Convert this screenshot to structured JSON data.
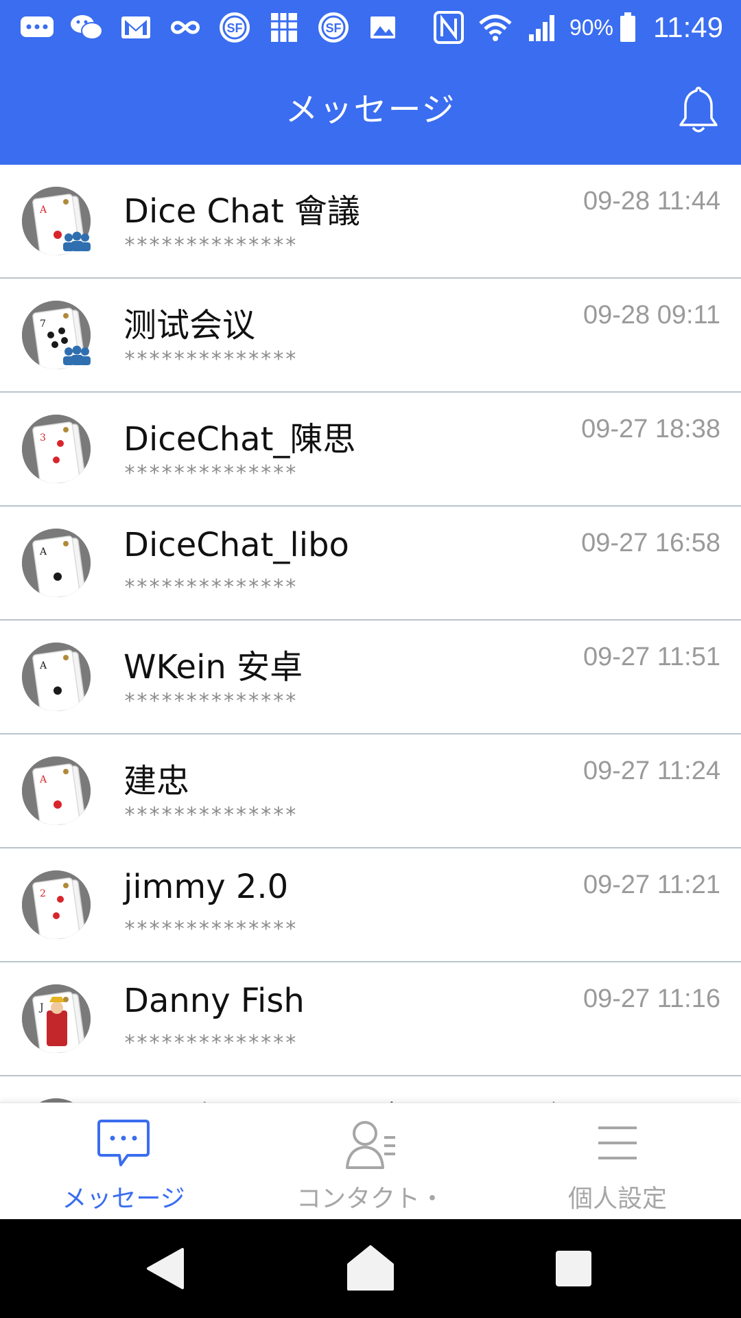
{
  "status_bar": {
    "left_icons": [
      "message-icon",
      "wechat-icon",
      "gmail-icon",
      "infinity-icon",
      "sf-icon",
      "grid-icon",
      "sf-icon",
      "image-icon"
    ],
    "right_icons": [
      "nfc-icon",
      "wifi-icon",
      "signal-icon",
      "battery-icon"
    ],
    "battery": "90%",
    "time": "11:49"
  },
  "header": {
    "title": "メッセージ"
  },
  "conversations": [
    {
      "name": "Dice Chat 會議",
      "preview": "**************",
      "time": "09-28 11:44",
      "group": true,
      "avatar_suit": "heart",
      "avatar_rank": "A"
    },
    {
      "name": "测试会议",
      "preview": "**************",
      "time": "09-28 09:11",
      "group": true,
      "avatar_suit": "spade",
      "avatar_rank": "7"
    },
    {
      "name": "DiceChat_陳思",
      "preview": "**************",
      "time": "09-27 18:38",
      "group": false,
      "avatar_suit": "heart",
      "avatar_rank": "3"
    },
    {
      "name": "DiceChat_libo",
      "preview": "**************",
      "time": "09-27 16:58",
      "group": false,
      "avatar_suit": "spade",
      "avatar_rank": "A"
    },
    {
      "name": "WKein 安卓",
      "preview": "**************",
      "time": "09-27 11:51",
      "group": false,
      "avatar_suit": "spade",
      "avatar_rank": "A"
    },
    {
      "name": "建忠",
      "preview": "**************",
      "time": "09-27 11:24",
      "group": false,
      "avatar_suit": "heart",
      "avatar_rank": "A"
    },
    {
      "name": "jimmy 2.0",
      "preview": "**************",
      "time": "09-27 11:21",
      "group": false,
      "avatar_suit": "heart",
      "avatar_rank": "2"
    },
    {
      "name": "Danny Fish",
      "preview": "**************",
      "time": "09-27 11:16",
      "group": false,
      "avatar_suit": "jack",
      "avatar_rank": "J"
    },
    {
      "name": "ホスタマー サービス アシスタント",
      "preview": "",
      "time": "",
      "group": false,
      "avatar_suit": "none",
      "avatar_rank": ""
    }
  ],
  "bottom_nav": {
    "tabs": [
      {
        "label": "メッセージ",
        "icon": "chat-bubble-icon",
        "active": true
      },
      {
        "label": "コンタクト・",
        "icon": "contacts-icon",
        "active": false
      },
      {
        "label": "個人設定",
        "icon": "list-icon",
        "active": false
      }
    ]
  },
  "colors": {
    "brand": "#3a6df0",
    "inactive": "#a6a6a6",
    "divider": "#b9c4cc",
    "time_text": "#9a9a9a"
  }
}
